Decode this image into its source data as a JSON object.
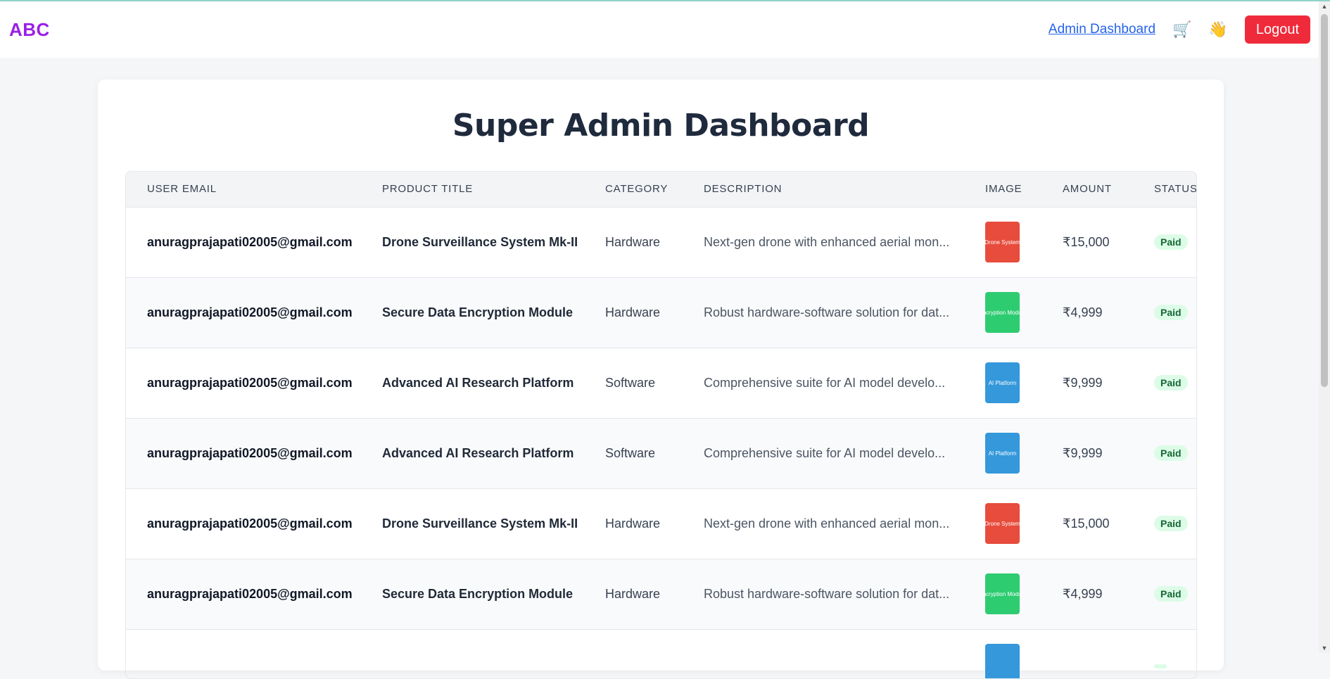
{
  "navbar": {
    "logo": "ABC",
    "admin_link": "Admin Dashboard",
    "cart_icon": "🛒",
    "wave_icon": "👋",
    "logout_label": "Logout"
  },
  "page": {
    "title": "Super Admin Dashboard"
  },
  "table": {
    "headers": {
      "email": "USER EMAIL",
      "product": "PRODUCT TITLE",
      "category": "CATEGORY",
      "description": "DESCRIPTION",
      "image": "IMAGE",
      "amount": "AMOUNT",
      "status": "STATUS"
    },
    "rows": [
      {
        "email": "anuragprajapati02005@gmail.com",
        "product": "Drone Surveillance System Mk-II",
        "category": "Hardware",
        "description": "Next-gen drone with enhanced aerial mon...",
        "image_text": "Drone System",
        "image_color": "#e74c3c",
        "amount": "₹15,000",
        "status": "Paid"
      },
      {
        "email": "anuragprajapati02005@gmail.com",
        "product": "Secure Data Encryption Module",
        "category": "Hardware",
        "description": "Robust hardware-software solution for dat...",
        "image_text": "Encryption Module",
        "image_color": "#2ecc71",
        "amount": "₹4,999",
        "status": "Paid"
      },
      {
        "email": "anuragprajapati02005@gmail.com",
        "product": "Advanced AI Research Platform",
        "category": "Software",
        "description": "Comprehensive suite for AI model develo...",
        "image_text": "AI Platform",
        "image_color": "#3498db",
        "amount": "₹9,999",
        "status": "Paid"
      },
      {
        "email": "anuragprajapati02005@gmail.com",
        "product": "Advanced AI Research Platform",
        "category": "Software",
        "description": "Comprehensive suite for AI model develo...",
        "image_text": "AI Platform",
        "image_color": "#3498db",
        "amount": "₹9,999",
        "status": "Paid"
      },
      {
        "email": "anuragprajapati02005@gmail.com",
        "product": "Drone Surveillance System Mk-II",
        "category": "Hardware",
        "description": "Next-gen drone with enhanced aerial mon...",
        "image_text": "Drone System",
        "image_color": "#e74c3c",
        "amount": "₹15,000",
        "status": "Paid"
      },
      {
        "email": "anuragprajapati02005@gmail.com",
        "product": "Secure Data Encryption Module",
        "category": "Hardware",
        "description": "Robust hardware-software solution for dat...",
        "image_text": "Encryption Module",
        "image_color": "#2ecc71",
        "amount": "₹4,999",
        "status": "Paid"
      },
      {
        "email": "",
        "product": "",
        "category": "",
        "description": "",
        "image_text": "",
        "image_color": "#3498db",
        "amount": "",
        "status": ""
      }
    ]
  }
}
